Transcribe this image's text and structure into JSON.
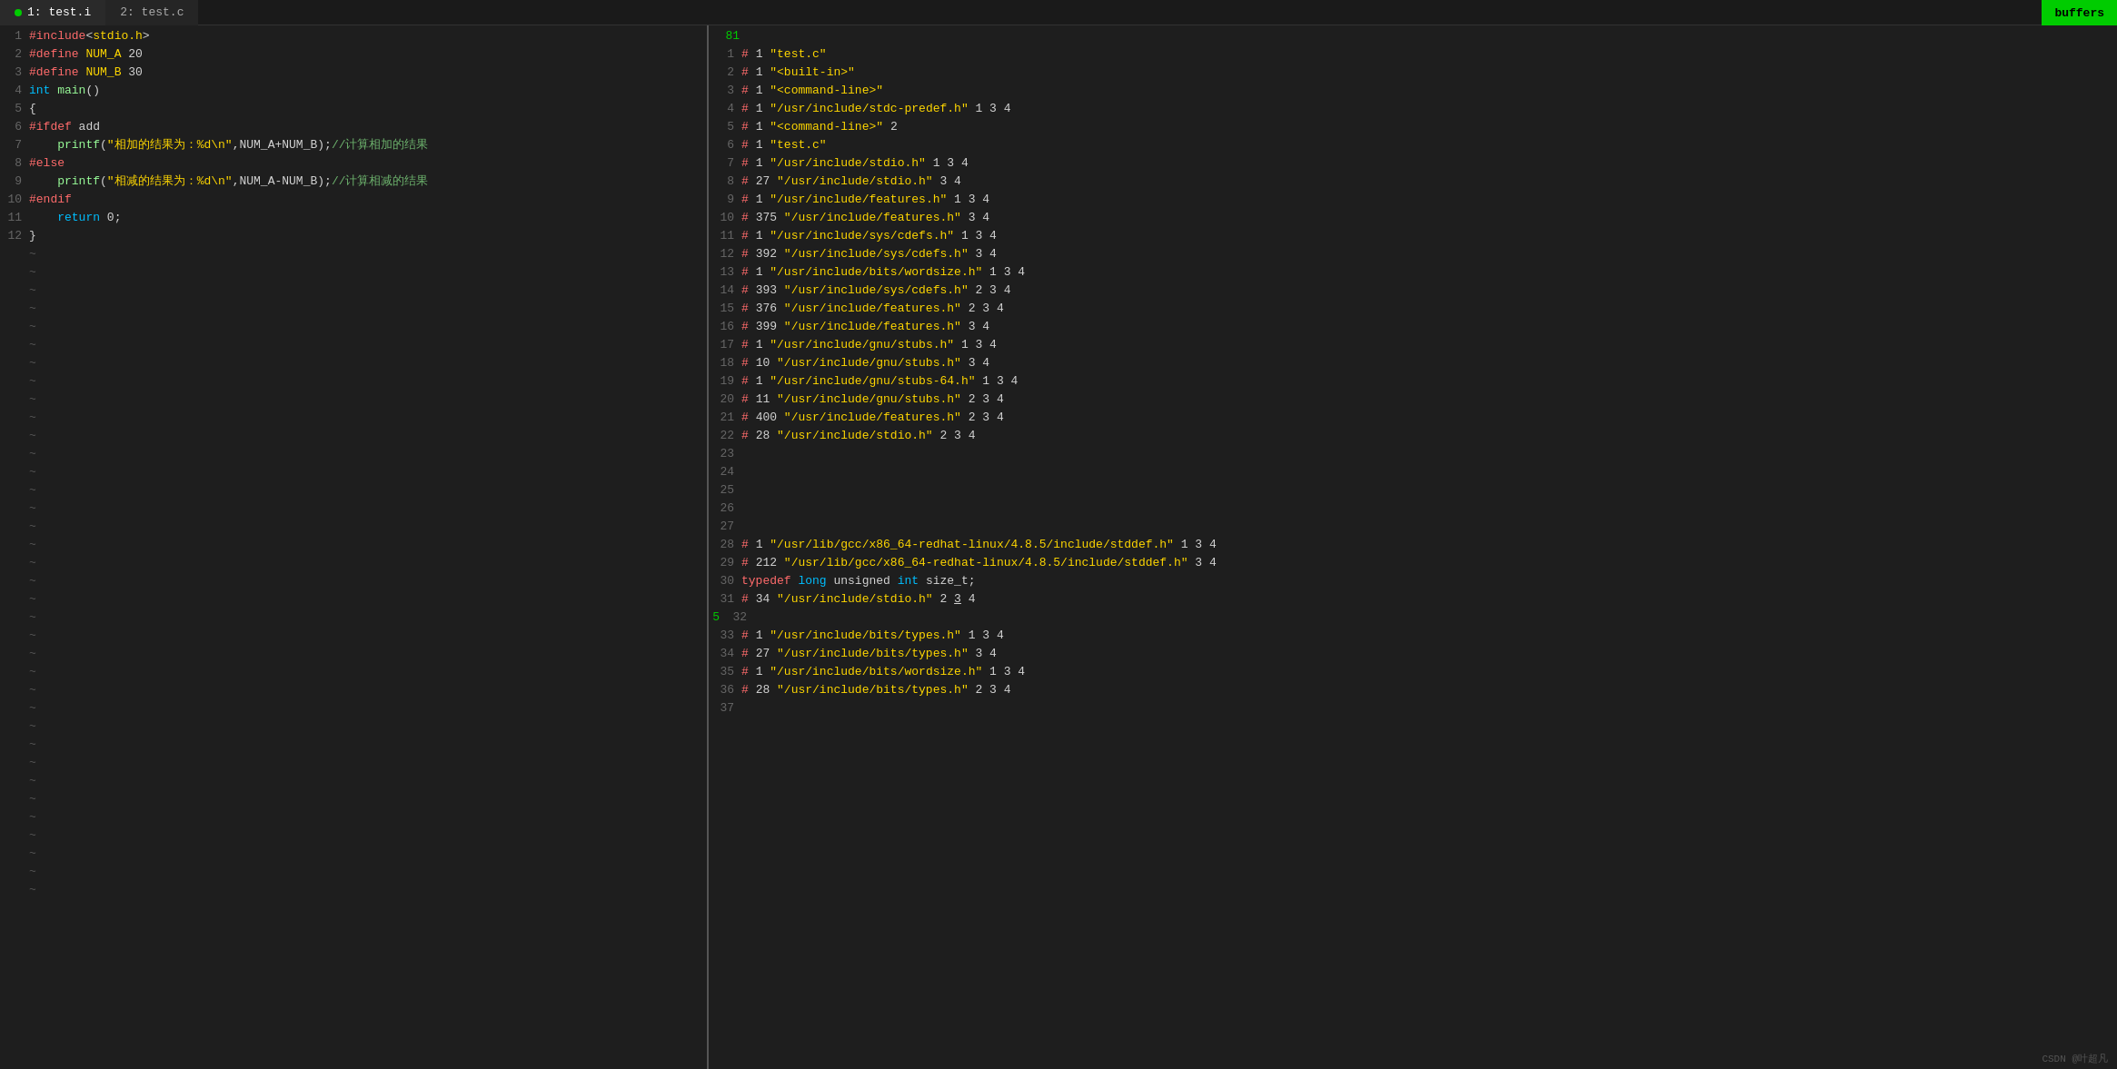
{
  "tabs": [
    {
      "label": "1: test.i",
      "active": true
    },
    {
      "label": "2: test.c",
      "active": false
    }
  ],
  "buffers_label": "buffers",
  "left_code": [
    {
      "num": "1",
      "content": "#include<stdio.h>",
      "type": "include"
    },
    {
      "num": "2",
      "content": "#define NUM_A 20",
      "type": "define"
    },
    {
      "num": "3",
      "content": "#define NUM_B 30",
      "type": "define"
    },
    {
      "num": "4",
      "content": "int main()",
      "type": "func"
    },
    {
      "num": "5",
      "content": "{",
      "type": "punct"
    },
    {
      "num": "6",
      "content": "#ifdef add",
      "type": "macro"
    },
    {
      "num": "7",
      "content": "    printf(\"相加的结果为：%d\\n\",NUM_A+NUM_B);//计算相加的结果",
      "type": "printf"
    },
    {
      "num": "8",
      "content": "#else",
      "type": "macro"
    },
    {
      "num": "9",
      "content": "    printf(\"相减的结果为：%d\\n\",NUM_A-NUM_B);//计算相减的结果",
      "type": "printf"
    },
    {
      "num": "10",
      "content": "#endif",
      "type": "macro"
    },
    {
      "num": "11",
      "content": "    return 0;",
      "type": "return"
    },
    {
      "num": "12",
      "content": "}",
      "type": "punct"
    }
  ],
  "right_pane_top_num": "81",
  "right_code": [
    {
      "num": "1",
      "content": "# 1 \"test.c\""
    },
    {
      "num": "2",
      "content": "# 1 \"<built-in>\""
    },
    {
      "num": "3",
      "content": "# 1 \"<command-line>\""
    },
    {
      "num": "4",
      "content": "# 1 \"/usr/include/stdc-predef.h\" 1 3 4"
    },
    {
      "num": "5",
      "content": "# 1 \"<command-line>\" 2"
    },
    {
      "num": "6",
      "content": "# 1 \"test.c\""
    },
    {
      "num": "7",
      "content": "# 1 \"/usr/include/stdio.h\" 1 3 4"
    },
    {
      "num": "8",
      "content": "# 27 \"/usr/include/stdio.h\" 3 4"
    },
    {
      "num": "9",
      "content": "# 1 \"/usr/include/features.h\" 1 3 4"
    },
    {
      "num": "10",
      "content": "# 375 \"/usr/include/features.h\" 3 4"
    },
    {
      "num": "11",
      "content": "# 1 \"/usr/include/sys/cdefs.h\" 1 3 4"
    },
    {
      "num": "12",
      "content": "# 392 \"/usr/include/sys/cdefs.h\" 3 4"
    },
    {
      "num": "13",
      "content": "# 1 \"/usr/include/bits/wordsize.h\" 1 3 4"
    },
    {
      "num": "14",
      "content": "# 393 \"/usr/include/sys/cdefs.h\" 2 3 4"
    },
    {
      "num": "15",
      "content": "# 376 \"/usr/include/features.h\" 2 3 4"
    },
    {
      "num": "16",
      "content": "# 399 \"/usr/include/features.h\" 3 4"
    },
    {
      "num": "17",
      "content": "# 1 \"/usr/include/gnu/stubs.h\" 1 3 4"
    },
    {
      "num": "18",
      "content": "# 10 \"/usr/include/gnu/stubs.h\" 3 4"
    },
    {
      "num": "19",
      "content": "# 1 \"/usr/include/gnu/stubs-64.h\" 1 3 4"
    },
    {
      "num": "20",
      "content": "# 11 \"/usr/include/gnu/stubs.h\" 2 3 4"
    },
    {
      "num": "21",
      "content": "# 400 \"/usr/include/features.h\" 2 3 4"
    },
    {
      "num": "22",
      "content": "# 28 \"/usr/include/stdio.h\" 2 3 4"
    },
    {
      "num": "23",
      "content": ""
    },
    {
      "num": "24",
      "content": ""
    },
    {
      "num": "25",
      "content": ""
    },
    {
      "num": "26",
      "content": ""
    },
    {
      "num": "27",
      "content": ""
    },
    {
      "num": "28",
      "content": "# 1 \"/usr/lib/gcc/x86_64-redhat-linux/4.8.5/include/stddef.h\" 1 3 4"
    },
    {
      "num": "29",
      "content": "# 212 \"/usr/lib/gcc/x86_64-redhat-linux/4.8.5/include/stddef.h\" 3 4"
    },
    {
      "num": "30",
      "content": "typedef long unsigned int size_t;"
    },
    {
      "num": "31",
      "content": "# 34 \"/usr/include/stdio.h\" 2 3 4"
    },
    {
      "num": "32",
      "content": ""
    },
    {
      "num": "33",
      "content": "# 1 \"/usr/include/bits/types.h\" 1 3 4"
    },
    {
      "num": "34",
      "content": "# 27 \"/usr/include/bits/types.h\" 3 4"
    },
    {
      "num": "35",
      "content": "# 1 \"/usr/include/bits/wordsize.h\" 1 3 4"
    },
    {
      "num": "36",
      "content": "# 28 \"/usr/include/bits/types.h\" 2 3 4"
    },
    {
      "num": "37",
      "content": ""
    }
  ],
  "watermark": "CSDN @叶超凡"
}
